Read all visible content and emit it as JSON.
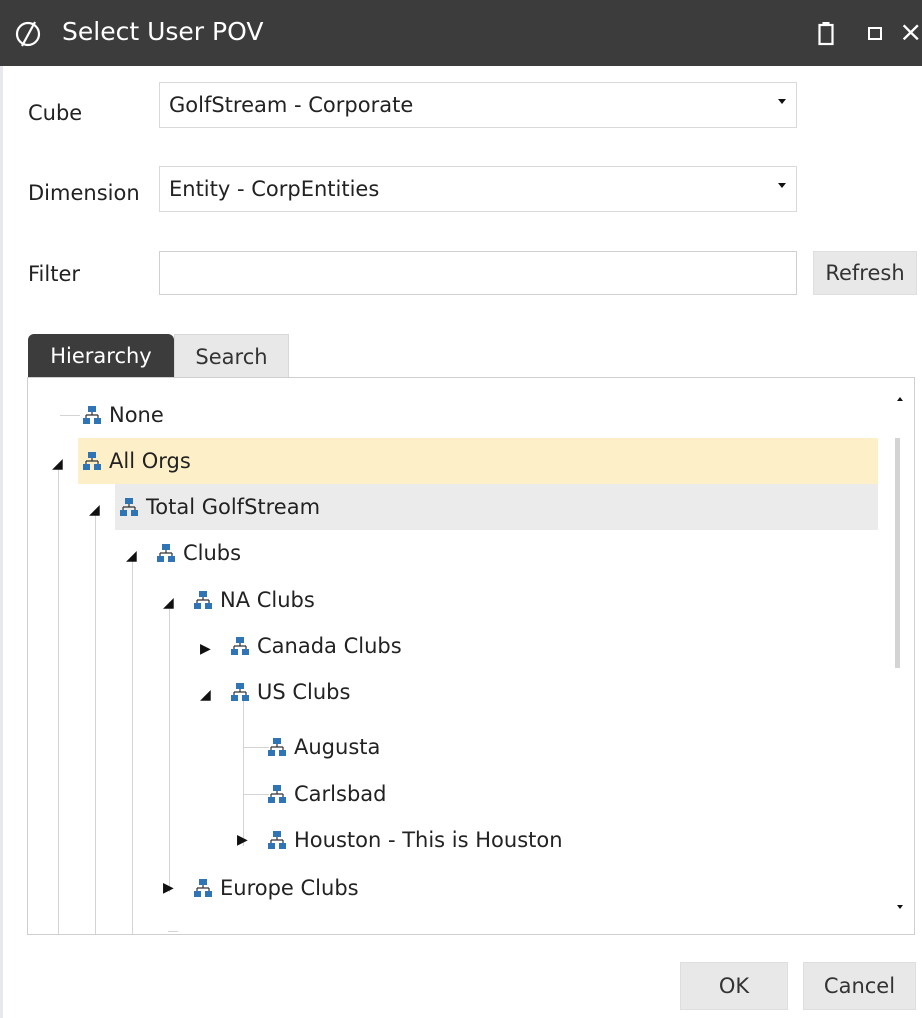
{
  "window": {
    "title": "Select User POV",
    "title_icon": "onestream-logo-icon",
    "controls": [
      "clipboard-icon",
      "maximize-icon",
      "close-icon"
    ],
    "close_glyph": "×"
  },
  "form": {
    "cube_label": "Cube",
    "cube_value": "GolfStream - Corporate",
    "dimension_label": "Dimension",
    "dimension_value": "Entity - CorpEntities",
    "filter_label": "Filter",
    "filter_value": "",
    "refresh_label": "Refresh"
  },
  "tabs": {
    "hierarchy": "Hierarchy",
    "search": "Search",
    "active": "Hierarchy"
  },
  "tree": {
    "nodes": [
      {
        "label": "None",
        "expander": "",
        "highlight": ""
      },
      {
        "label": "All Orgs",
        "expander": "expanded",
        "highlight": "selected"
      },
      {
        "label": "Total GolfStream",
        "expander": "expanded",
        "highlight": "hover"
      },
      {
        "label": "Clubs",
        "expander": "expanded",
        "highlight": ""
      },
      {
        "label": "NA Clubs",
        "expander": "expanded",
        "highlight": ""
      },
      {
        "label": "Canada Clubs",
        "expander": "collapsed",
        "highlight": ""
      },
      {
        "label": "US Clubs",
        "expander": "expanded",
        "highlight": ""
      },
      {
        "label": "Augusta",
        "expander": "",
        "highlight": ""
      },
      {
        "label": "Carlsbad",
        "expander": "",
        "highlight": ""
      },
      {
        "label": "Houston - This is Houston",
        "expander": "collapsed",
        "highlight": ""
      },
      {
        "label": "Europe Clubs",
        "expander": "collapsed",
        "highlight": ""
      }
    ]
  },
  "footer": {
    "ok_label": "OK",
    "cancel_label": "Cancel"
  },
  "colors": {
    "titlebar": "#3c3c3c",
    "selected_row": "#fdf0c8",
    "hover_row": "#ebebeb",
    "node_icon": "#2f74b5",
    "button_bg": "#e8e8e8"
  }
}
